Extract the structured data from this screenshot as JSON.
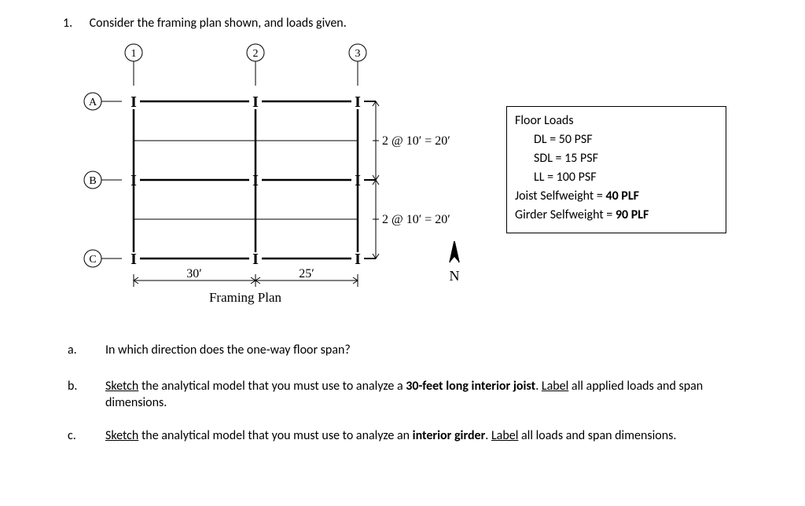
{
  "question_number": "1.",
  "intro": "Consider the framing plan shown, and loads given.",
  "grid_cols": [
    "1",
    "2",
    "3"
  ],
  "grid_rows": [
    "A",
    "B",
    "C"
  ],
  "dim_top": "2 @ 10′  =  20′",
  "dim_bot": "2 @ 10′  =  20′",
  "span1": "30′",
  "span2": "25′",
  "caption": "Framing Plan",
  "north": "N",
  "loads": {
    "title": "Floor Loads",
    "dl": "DL = 50 PSF",
    "sdl": "SDL = 15 PSF",
    "ll": "LL = 100 PSF",
    "joist": "Joist Selfweight = ",
    "joist_v": "40 PLF",
    "girder": "Girder Selfweight = ",
    "girder_v": "90 PLF"
  },
  "parts": {
    "a_let": "a.",
    "a": "In which direction does the one-way floor span?",
    "b_let": "b.",
    "b_pre": " the analytical model that you must use to analyze a ",
    "b_u1": "Sketch",
    "b_bold": "30-feet long interior joist",
    "b_mid": ". ",
    "b_u2": "Label",
    "b_post": " all applied loads and span dimensions.",
    "c_let": "c.",
    "c_u1": "Sketch",
    "c_pre": " the analytical model that you must use to analyze an ",
    "c_bold": "interior girder",
    "c_mid": ". ",
    "c_u2": "Label",
    "c_post": " all loads and span dimensions."
  }
}
